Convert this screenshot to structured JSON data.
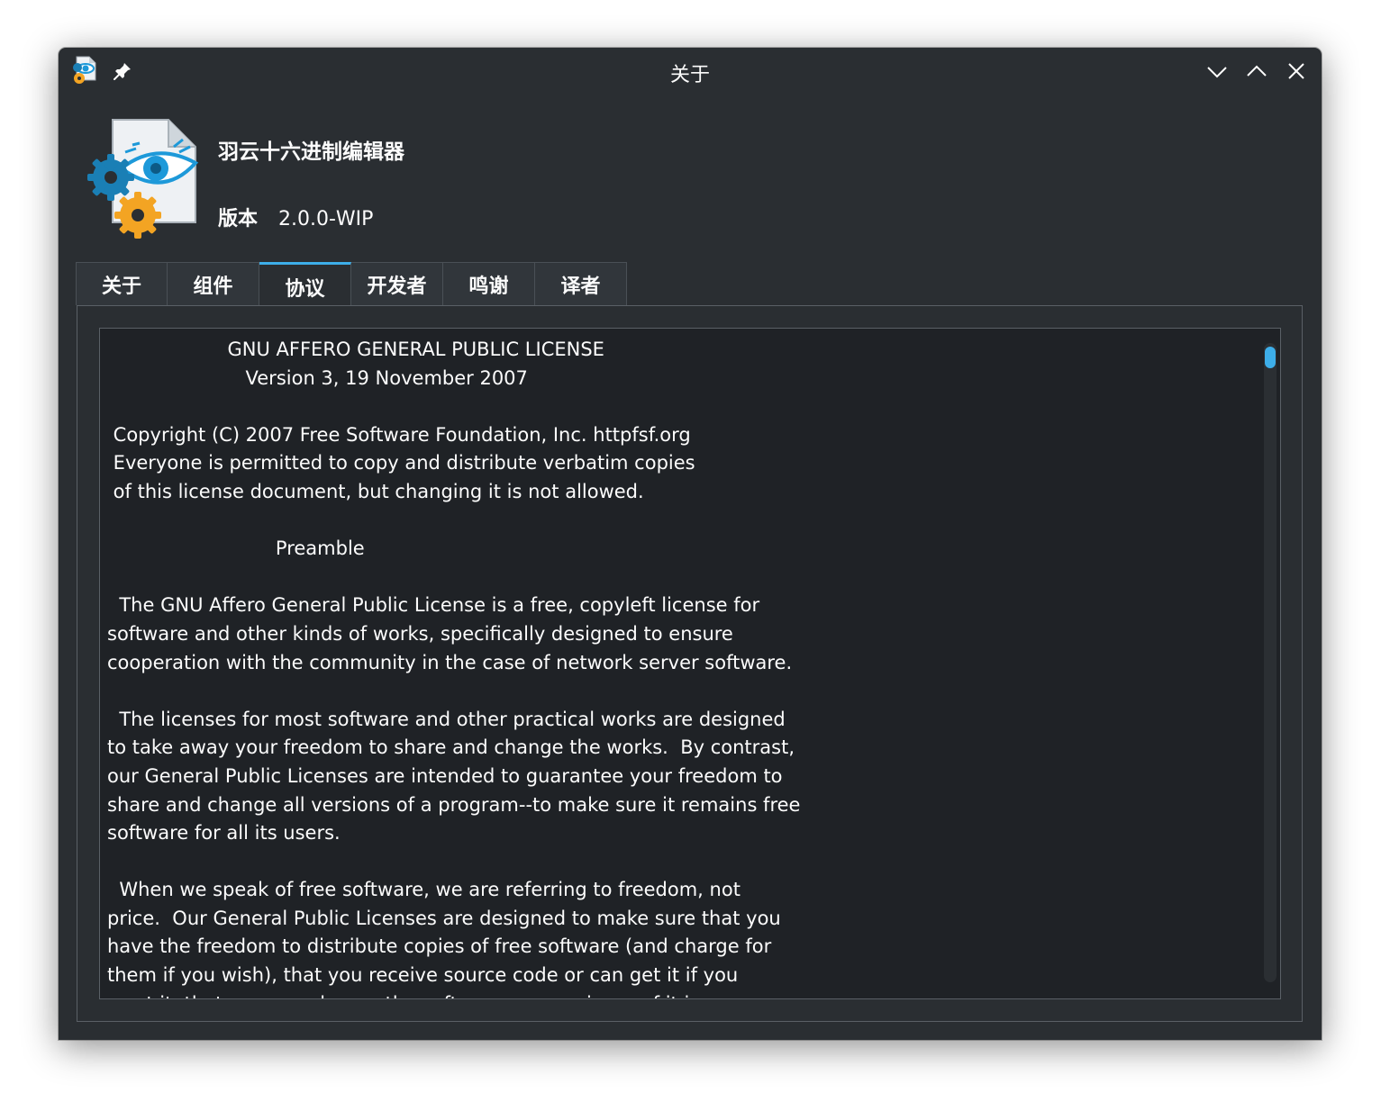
{
  "window": {
    "title": "关于",
    "app_icon": "app-icon",
    "pin_icon": "pin-icon",
    "controls": [
      "minimize-icon",
      "maximize-icon",
      "close-icon"
    ]
  },
  "header": {
    "app_name": "羽云十六进制编辑器",
    "version_label": "版本",
    "version_value": "2.0.0-WIP"
  },
  "tabs": [
    {
      "label": "关于",
      "active": false
    },
    {
      "label": "组件",
      "active": false
    },
    {
      "label": "协议",
      "active": true
    },
    {
      "label": "开发者",
      "active": false
    },
    {
      "label": "鸣谢",
      "active": false
    },
    {
      "label": "译者",
      "active": false
    }
  ],
  "license": {
    "text": "                    GNU AFFERO GENERAL PUBLIC LICENSE\n                       Version 3, 19 November 2007\n\n Copyright (C) 2007 Free Software Foundation, Inc. httpfsf.org\n Everyone is permitted to copy and distribute verbatim copies\n of this license document, but changing it is not allowed.\n\n                            Preamble\n\n  The GNU Affero General Public License is a free, copyleft license for\nsoftware and other kinds of works, specifically designed to ensure\ncooperation with the community in the case of network server software.\n\n  The licenses for most software and other practical works are designed\nto take away your freedom to share and change the works.  By contrast,\nour General Public Licenses are intended to guarantee your freedom to\nshare and change all versions of a program--to make sure it remains free\nsoftware for all its users.\n\n  When we speak of free software, we are referring to freedom, not\nprice.  Our General Public Licenses are designed to make sure that you\nhave the freedom to distribute copies of free software (and charge for\nthem if you wish), that you receive source code or can get it if you\nwant it, that you can change the software or use pieces of it in new"
  },
  "colors": {
    "accent": "#3daee9",
    "window_bg": "#2a2e32",
    "text_bg": "#1f2226",
    "text": "#fcfcfc"
  }
}
